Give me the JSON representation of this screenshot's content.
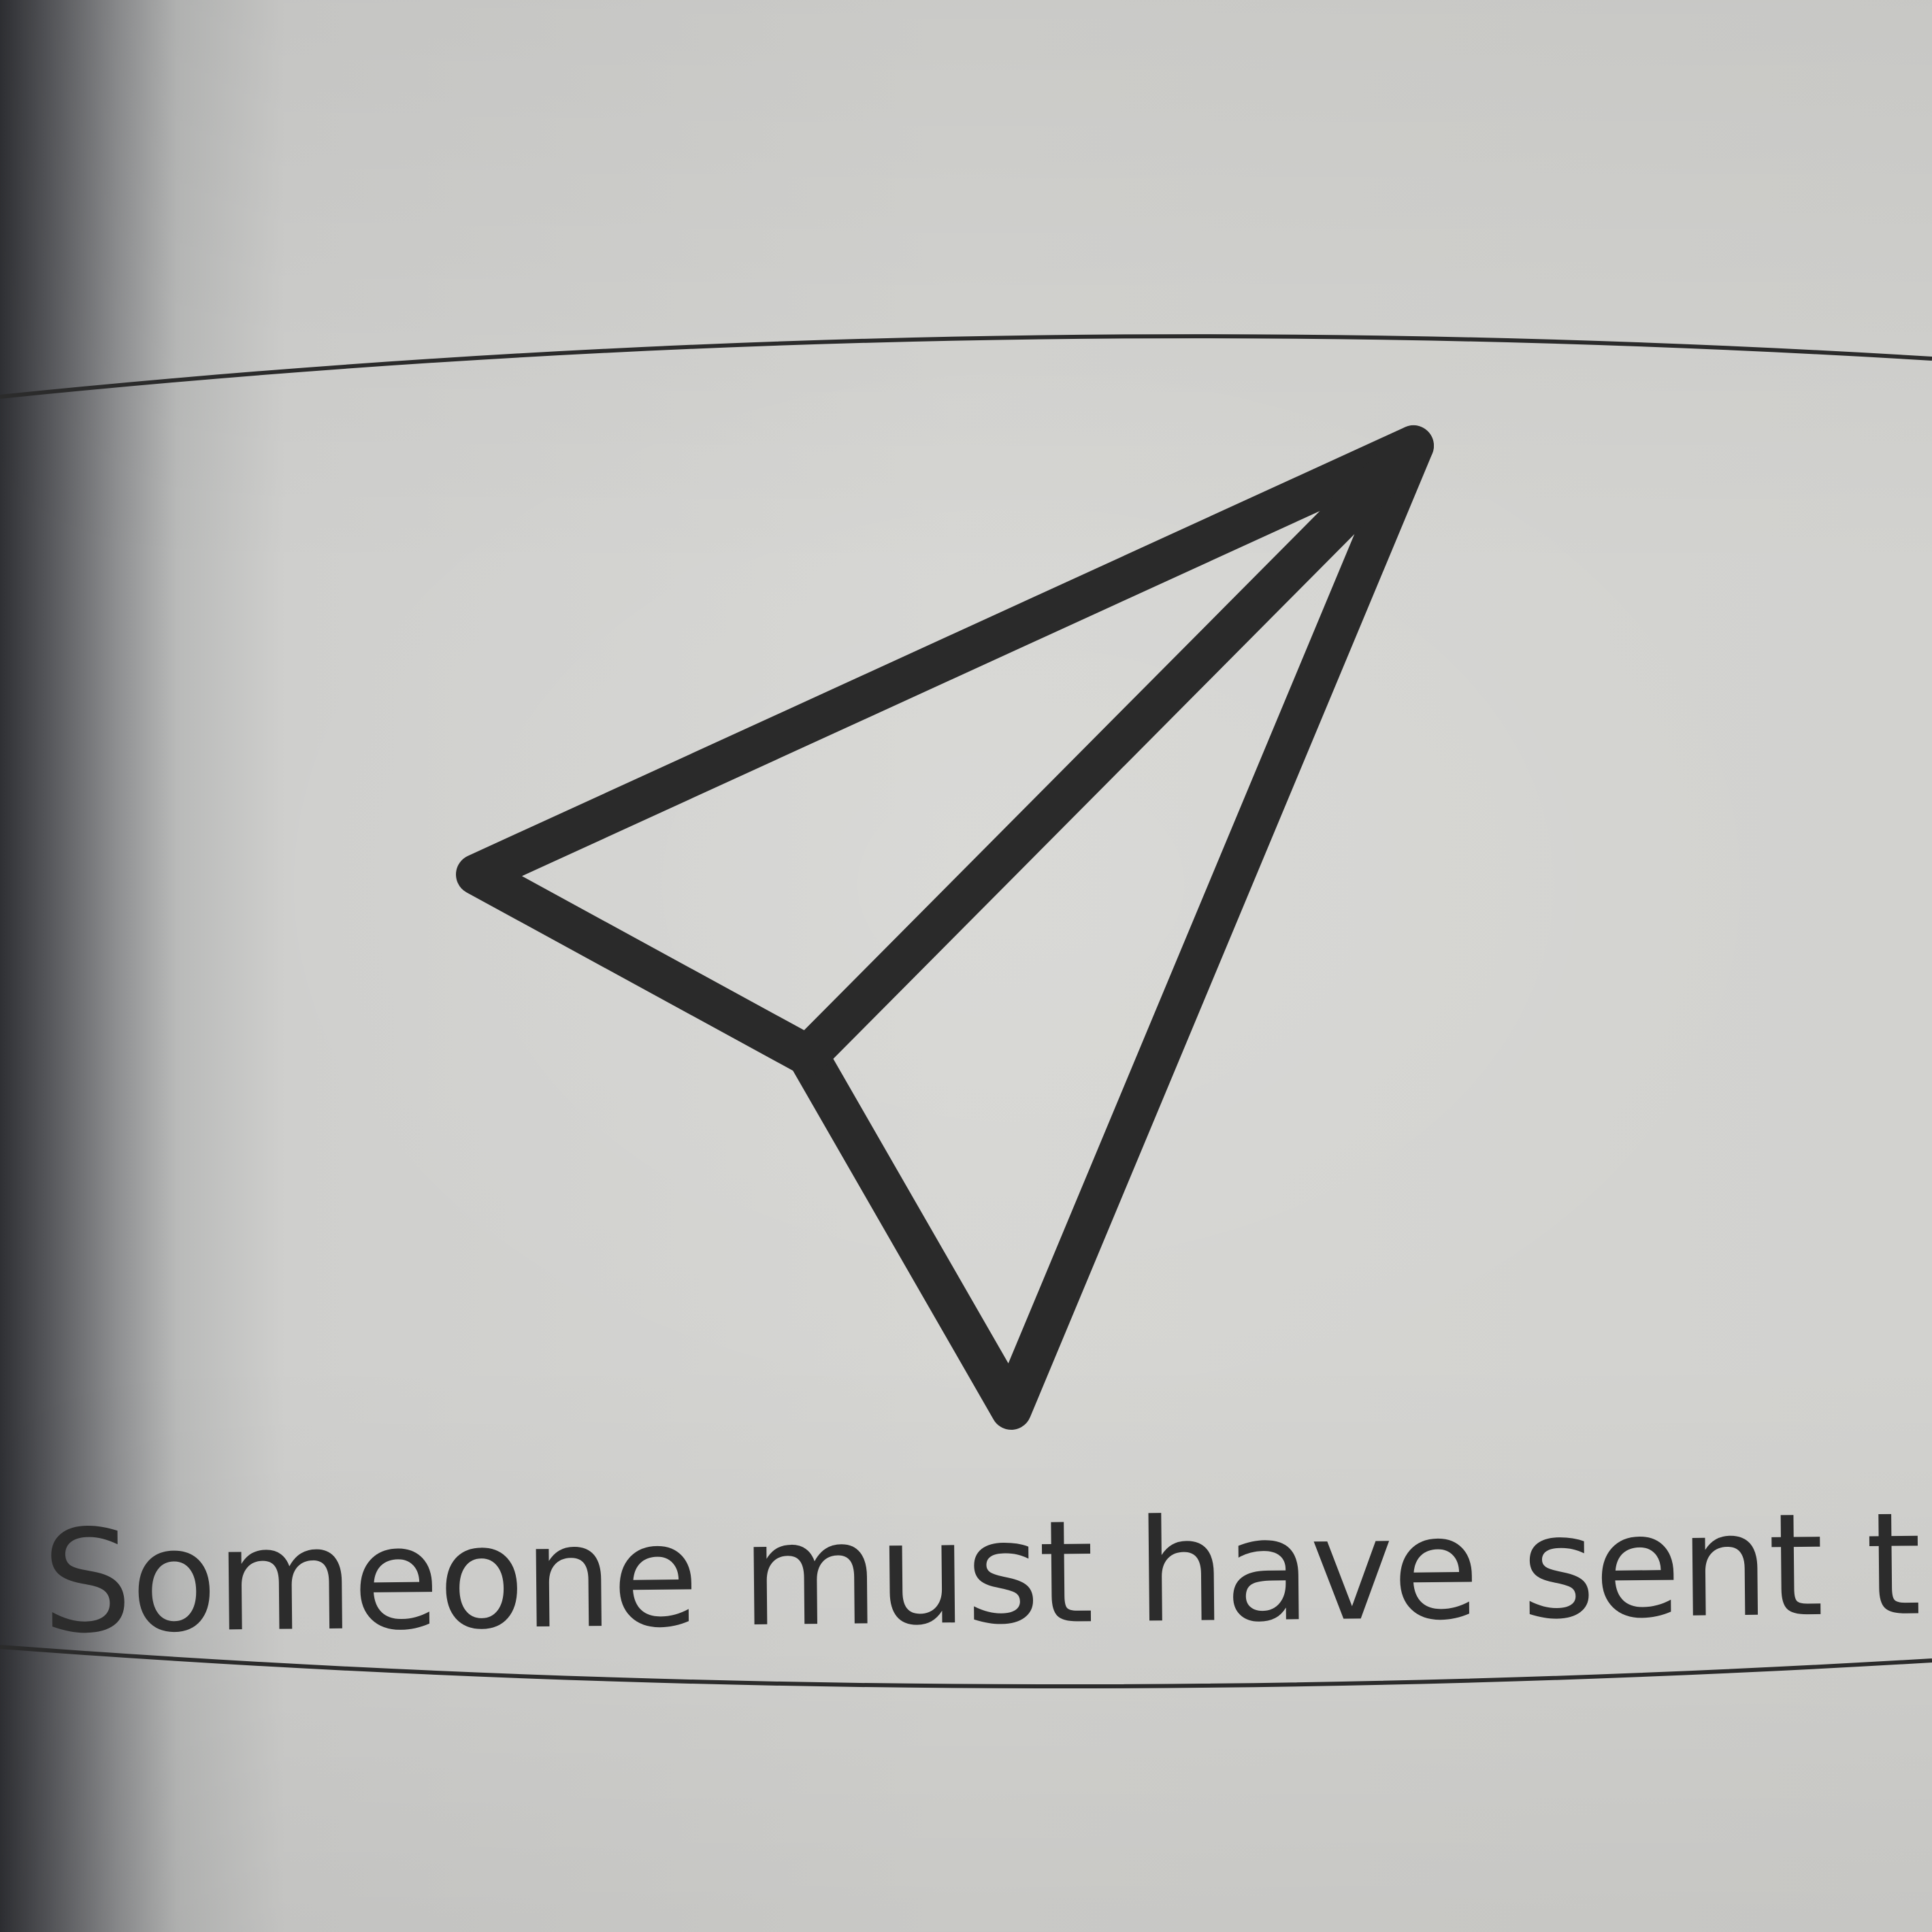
{
  "caption": {
    "text": "Someone must have sent them for..."
  },
  "icon": {
    "name": "paper-plane-icon",
    "color": "#2a2a2a"
  },
  "colors": {
    "paper": "#d4d4d1",
    "ink": "#2a2a2a",
    "binding_shadow": "#2f3034"
  }
}
